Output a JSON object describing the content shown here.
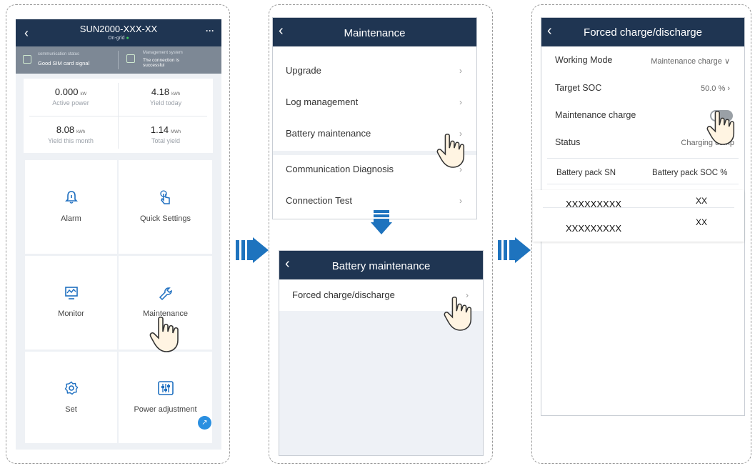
{
  "screen1": {
    "title": "SUN2000-XXX-XX",
    "grid_status": "On-grid",
    "comm_status_label": "communication status",
    "comm_status_value": "Good SIM card signal",
    "mgmt_label": "Management system",
    "mgmt_value_line1": "The connection is",
    "mgmt_value_line2": "successful",
    "stats": [
      {
        "value": "0.000",
        "unit": "kW",
        "label": "Active power"
      },
      {
        "value": "4.18",
        "unit": "kWh",
        "label": "Yield today"
      },
      {
        "value": "8.08",
        "unit": "kWh",
        "label": "Yield this month"
      },
      {
        "value": "1.14",
        "unit": "MWh",
        "label": "Total yield"
      }
    ],
    "tiles": [
      {
        "label": "Alarm",
        "icon": "bell-icon"
      },
      {
        "label": "Quick Settings",
        "icon": "hand-tap-icon"
      },
      {
        "label": "Monitor",
        "icon": "monitor-icon"
      },
      {
        "label": "Maintenance",
        "icon": "wrench-icon"
      },
      {
        "label": "Set",
        "icon": "gear-icon"
      },
      {
        "label": "Power adjustment",
        "icon": "sliders-icon"
      }
    ]
  },
  "screen2": {
    "title": "Maintenance",
    "items": [
      "Upgrade",
      "Log management",
      "Battery maintenance",
      "Communication Diagnosis",
      "Connection Test"
    ]
  },
  "screen2b": {
    "title": "Battery maintenance",
    "items": [
      "Forced charge/discharge"
    ]
  },
  "screen3": {
    "title": "Forced charge/discharge",
    "working_mode_label": "Working Mode",
    "working_mode_value": "Maintenance charge",
    "target_soc_label": "Target SOC",
    "target_soc_value": "50.0 %",
    "maint_charge_label": "Maintenance charge",
    "status_label": "Status",
    "status_value": "Charging comp",
    "table_headers": [
      "Battery pack SN",
      "Battery pack SOC %"
    ],
    "table_rows": [
      {
        "sn": "XXXXXXXXX",
        "soc": "XX"
      },
      {
        "sn": "XXXXXXXXX",
        "soc": "XX"
      }
    ]
  },
  "colors": {
    "header": "#1f3552",
    "arrow": "#1e73be",
    "status_bar": "#7d8895"
  }
}
